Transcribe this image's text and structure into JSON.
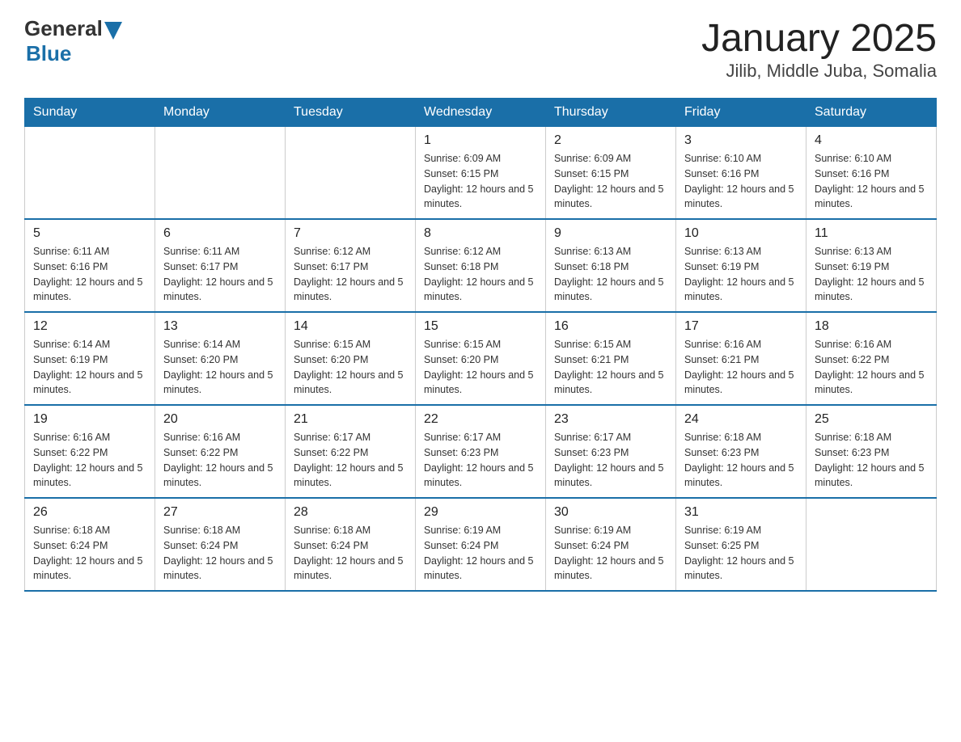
{
  "logo": {
    "general": "General",
    "blue": "Blue"
  },
  "header": {
    "title": "January 2025",
    "subtitle": "Jilib, Middle Juba, Somalia"
  },
  "days_of_week": [
    "Sunday",
    "Monday",
    "Tuesday",
    "Wednesday",
    "Thursday",
    "Friday",
    "Saturday"
  ],
  "weeks": [
    [
      {
        "day": "",
        "info": ""
      },
      {
        "day": "",
        "info": ""
      },
      {
        "day": "",
        "info": ""
      },
      {
        "day": "1",
        "info": "Sunrise: 6:09 AM\nSunset: 6:15 PM\nDaylight: 12 hours and 5 minutes."
      },
      {
        "day": "2",
        "info": "Sunrise: 6:09 AM\nSunset: 6:15 PM\nDaylight: 12 hours and 5 minutes."
      },
      {
        "day": "3",
        "info": "Sunrise: 6:10 AM\nSunset: 6:16 PM\nDaylight: 12 hours and 5 minutes."
      },
      {
        "day": "4",
        "info": "Sunrise: 6:10 AM\nSunset: 6:16 PM\nDaylight: 12 hours and 5 minutes."
      }
    ],
    [
      {
        "day": "5",
        "info": "Sunrise: 6:11 AM\nSunset: 6:16 PM\nDaylight: 12 hours and 5 minutes."
      },
      {
        "day": "6",
        "info": "Sunrise: 6:11 AM\nSunset: 6:17 PM\nDaylight: 12 hours and 5 minutes."
      },
      {
        "day": "7",
        "info": "Sunrise: 6:12 AM\nSunset: 6:17 PM\nDaylight: 12 hours and 5 minutes."
      },
      {
        "day": "8",
        "info": "Sunrise: 6:12 AM\nSunset: 6:18 PM\nDaylight: 12 hours and 5 minutes."
      },
      {
        "day": "9",
        "info": "Sunrise: 6:13 AM\nSunset: 6:18 PM\nDaylight: 12 hours and 5 minutes."
      },
      {
        "day": "10",
        "info": "Sunrise: 6:13 AM\nSunset: 6:19 PM\nDaylight: 12 hours and 5 minutes."
      },
      {
        "day": "11",
        "info": "Sunrise: 6:13 AM\nSunset: 6:19 PM\nDaylight: 12 hours and 5 minutes."
      }
    ],
    [
      {
        "day": "12",
        "info": "Sunrise: 6:14 AM\nSunset: 6:19 PM\nDaylight: 12 hours and 5 minutes."
      },
      {
        "day": "13",
        "info": "Sunrise: 6:14 AM\nSunset: 6:20 PM\nDaylight: 12 hours and 5 minutes."
      },
      {
        "day": "14",
        "info": "Sunrise: 6:15 AM\nSunset: 6:20 PM\nDaylight: 12 hours and 5 minutes."
      },
      {
        "day": "15",
        "info": "Sunrise: 6:15 AM\nSunset: 6:20 PM\nDaylight: 12 hours and 5 minutes."
      },
      {
        "day": "16",
        "info": "Sunrise: 6:15 AM\nSunset: 6:21 PM\nDaylight: 12 hours and 5 minutes."
      },
      {
        "day": "17",
        "info": "Sunrise: 6:16 AM\nSunset: 6:21 PM\nDaylight: 12 hours and 5 minutes."
      },
      {
        "day": "18",
        "info": "Sunrise: 6:16 AM\nSunset: 6:22 PM\nDaylight: 12 hours and 5 minutes."
      }
    ],
    [
      {
        "day": "19",
        "info": "Sunrise: 6:16 AM\nSunset: 6:22 PM\nDaylight: 12 hours and 5 minutes."
      },
      {
        "day": "20",
        "info": "Sunrise: 6:16 AM\nSunset: 6:22 PM\nDaylight: 12 hours and 5 minutes."
      },
      {
        "day": "21",
        "info": "Sunrise: 6:17 AM\nSunset: 6:22 PM\nDaylight: 12 hours and 5 minutes."
      },
      {
        "day": "22",
        "info": "Sunrise: 6:17 AM\nSunset: 6:23 PM\nDaylight: 12 hours and 5 minutes."
      },
      {
        "day": "23",
        "info": "Sunrise: 6:17 AM\nSunset: 6:23 PM\nDaylight: 12 hours and 5 minutes."
      },
      {
        "day": "24",
        "info": "Sunrise: 6:18 AM\nSunset: 6:23 PM\nDaylight: 12 hours and 5 minutes."
      },
      {
        "day": "25",
        "info": "Sunrise: 6:18 AM\nSunset: 6:23 PM\nDaylight: 12 hours and 5 minutes."
      }
    ],
    [
      {
        "day": "26",
        "info": "Sunrise: 6:18 AM\nSunset: 6:24 PM\nDaylight: 12 hours and 5 minutes."
      },
      {
        "day": "27",
        "info": "Sunrise: 6:18 AM\nSunset: 6:24 PM\nDaylight: 12 hours and 5 minutes."
      },
      {
        "day": "28",
        "info": "Sunrise: 6:18 AM\nSunset: 6:24 PM\nDaylight: 12 hours and 5 minutes."
      },
      {
        "day": "29",
        "info": "Sunrise: 6:19 AM\nSunset: 6:24 PM\nDaylight: 12 hours and 5 minutes."
      },
      {
        "day": "30",
        "info": "Sunrise: 6:19 AM\nSunset: 6:24 PM\nDaylight: 12 hours and 5 minutes."
      },
      {
        "day": "31",
        "info": "Sunrise: 6:19 AM\nSunset: 6:25 PM\nDaylight: 12 hours and 5 minutes."
      },
      {
        "day": "",
        "info": ""
      }
    ]
  ]
}
